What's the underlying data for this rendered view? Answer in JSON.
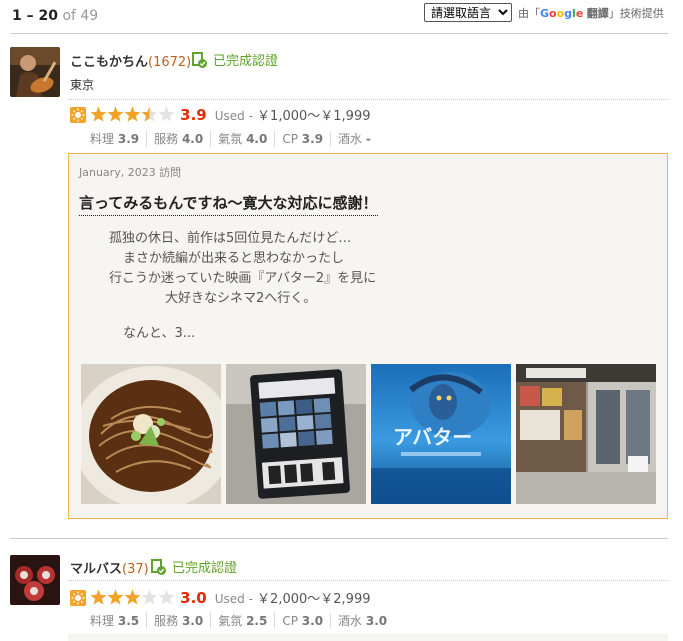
{
  "header": {
    "range": "1 – 20",
    "total": "of 49",
    "lang_select_value": "請選取語言",
    "credit_prefix": "由",
    "credit_google": [
      "G",
      "o",
      "o",
      "g",
      "l",
      "e"
    ],
    "credit_suffix": "翻譯",
    "credit_tail": "技術提供"
  },
  "reviews": [
    {
      "user": "ここもかちん",
      "count": "(1672)",
      "verified": "已完成認證",
      "location": "東京",
      "stars": 3.5,
      "score": "3.9",
      "used_label": "Used -",
      "price": "￥1,000～￥1,999",
      "subs": [
        {
          "label": "料理",
          "value": "3.9"
        },
        {
          "label": "服務",
          "value": "4.0"
        },
        {
          "label": "氣氛",
          "value": "4.0"
        },
        {
          "label": "CP",
          "value": "3.9"
        },
        {
          "label": "酒水",
          "value": "-"
        }
      ],
      "visit": "January, 2023 訪問",
      "title": "言ってみるもんですね～寛大な対応に感謝！",
      "body_lines": [
        "孤独の休日、前作は5回位見たんだけど…",
        "まさか続編が出来ると思わなかったし",
        "行こうか迷っていた映画『アバター2』を見に",
        "大好きなシネマ2へ行く。",
        "",
        "なんと、3..."
      ],
      "photos": [
        "soba-noodle-photo",
        "ticket-machine-photo",
        "avatar-poster-photo",
        "shop-storefront-photo"
      ],
      "poster_text": "アバター"
    },
    {
      "user": "マルバス",
      "count": "(37)",
      "verified": "已完成認證",
      "stars": 3,
      "score": "3.0",
      "used_label": "Used -",
      "price": "￥2,000～￥2,999",
      "subs": [
        {
          "label": "料理",
          "value": "3.5"
        },
        {
          "label": "服務",
          "value": "3.0"
        },
        {
          "label": "氣氛",
          "value": "2.5"
        },
        {
          "label": "CP",
          "value": "3.0"
        },
        {
          "label": "酒水",
          "value": "3.0"
        }
      ]
    }
  ],
  "colors": {
    "score": "#e32a00",
    "star": "#f3a327",
    "border": "#f0b449",
    "verified": "#60a32a"
  }
}
